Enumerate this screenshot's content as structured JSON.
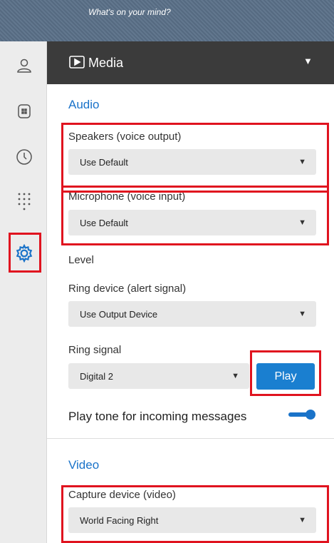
{
  "topbar": {
    "placeholder": "What's on your mind?"
  },
  "leftrail": {
    "items": [
      {
        "icon": "user-icon"
      },
      {
        "icon": "building-icon"
      },
      {
        "icon": "clock-icon"
      },
      {
        "icon": "dialpad-icon"
      },
      {
        "icon": "gear-icon",
        "active": true
      }
    ]
  },
  "header": {
    "title": "Media",
    "caret": "▼"
  },
  "audio": {
    "section_title": "Audio",
    "speakers": {
      "label": "Speakers (voice output)",
      "value": "Use Default"
    },
    "microphone": {
      "label": "Microphone (voice input)",
      "value": "Use Default"
    },
    "level_label": "Level",
    "ring_device": {
      "label": "Ring device (alert signal)",
      "value": "Use Output Device"
    },
    "ring_signal": {
      "label": "Ring signal",
      "value": "Digital 2",
      "play_label": "Play"
    },
    "incoming_tone": {
      "label": "Play tone for incoming messages",
      "enabled": true
    }
  },
  "video": {
    "section_title": "Video",
    "capture": {
      "label": "Capture device (video)",
      "value": "World Facing Right"
    }
  },
  "dropdown_caret": "▼",
  "colors": {
    "accent": "#1a73c9",
    "highlight": "#e0131f",
    "header_bg": "#3b3b3b"
  }
}
